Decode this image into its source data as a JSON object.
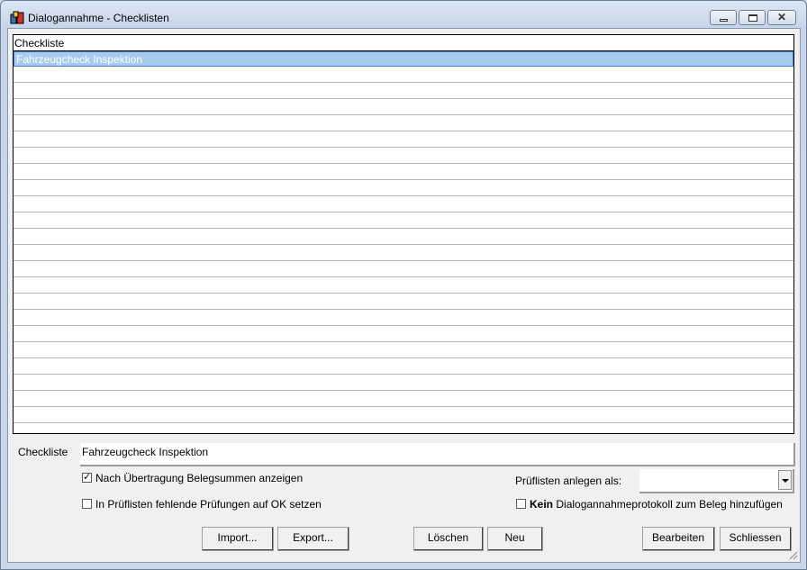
{
  "window": {
    "title": "Dialogannahme - Checklisten",
    "close_glyph": "✕"
  },
  "grid": {
    "header": "Checkliste",
    "rows": [
      "Fahrzeugcheck Inspektion"
    ],
    "selection_color": "#a6cbef"
  },
  "form": {
    "checkliste_label": "Checkliste",
    "checkliste_value": "Fahrzeugcheck Inspektion",
    "opt1": {
      "label": "Nach Übertragung Belegsummen anzeigen",
      "checked": true,
      "mark": "✓"
    },
    "opt2": {
      "label": "In Prüflisten fehlende Prüfungen auf OK setzen",
      "checked": false
    },
    "pruef_label": "Prüflisten anlegen als:",
    "pruef_value": "",
    "opt3": {
      "bold": "Kein",
      "label": "Dialogannahmeprotokoll zum Beleg hinzufügen",
      "checked": false
    }
  },
  "buttons": {
    "import": "Import...",
    "export": "Export...",
    "loeschen": "Löschen",
    "neu": "Neu",
    "bearbeiten": "Bearbeiten",
    "schliessen": "Schliessen"
  }
}
